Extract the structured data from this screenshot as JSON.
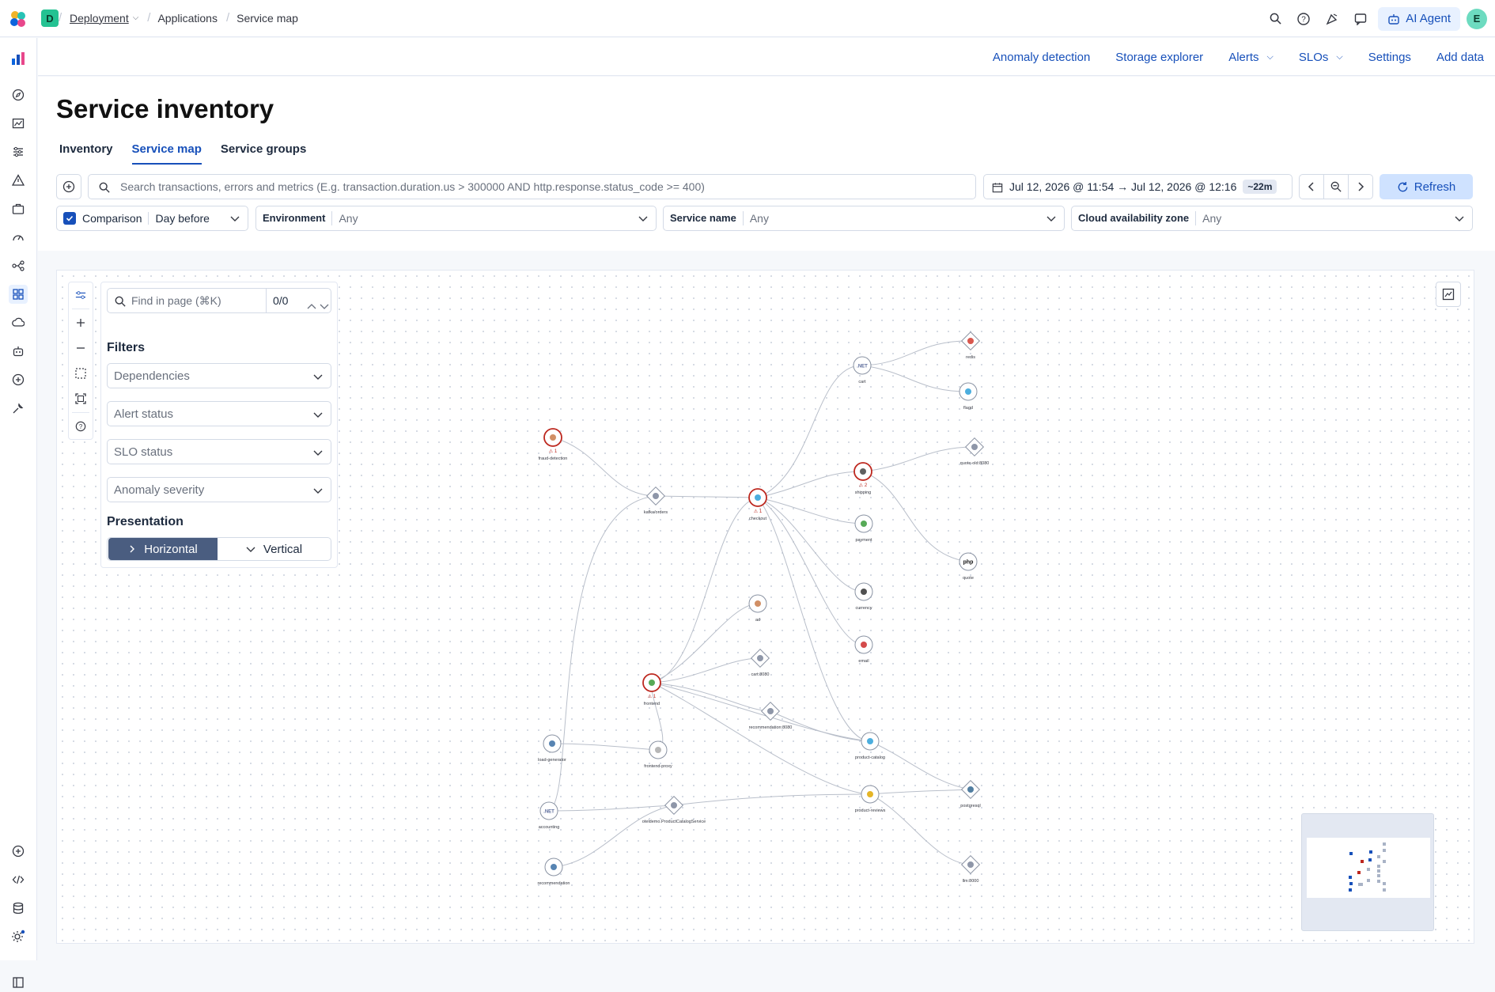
{
  "breadcrumbs": {
    "space_initial": "D",
    "items": [
      "Deployment",
      "Applications",
      "Service map"
    ]
  },
  "topbar": {
    "ai_agent_label": "AI Agent",
    "user_initial": "E"
  },
  "subnav": {
    "items": [
      "Anomaly detection",
      "Storage explorer",
      "Alerts",
      "SLOs",
      "Settings",
      "Add data"
    ]
  },
  "page": {
    "title": "Service inventory",
    "tabs": [
      "Inventory",
      "Service map",
      "Service groups"
    ],
    "selected_tab": "Service map"
  },
  "query": {
    "placeholder": "Search transactions, errors and metrics (E.g. transaction.duration.us > 300000 AND http.response.status_code >= 400)"
  },
  "date": {
    "range": "Jul 12, 2026 @ 11:54 → Jul 12, 2026 @ 12:16",
    "duration": "~22m",
    "refresh_label": "Refresh"
  },
  "filters": {
    "comparison_label": "Comparison",
    "comparison_checked": true,
    "comparison_value": "Day before",
    "environment_label": "Environment",
    "environment_value": "Any",
    "service_name_label": "Service name",
    "service_name_value": "Any",
    "cloud_zone_label": "Cloud availability zone",
    "cloud_zone_value": "Any"
  },
  "map_panel": {
    "find_placeholder": "Find in page (⌘K)",
    "find_count": "0/0",
    "filters_heading": "Filters",
    "dropdowns": [
      "Dependencies",
      "Alert status",
      "SLO status",
      "Anomaly severity"
    ],
    "presentation_heading": "Presentation",
    "presentation_options": [
      "Horizontal",
      "Vertical"
    ],
    "presentation_selected": "Horizontal"
  },
  "nodes": [
    {
      "id": "fraud-detection",
      "label": "fraud-detection",
      "kind": "service",
      "alerts": "1"
    },
    {
      "id": "kafka",
      "label": "kafka/orders",
      "kind": "dependency"
    },
    {
      "id": "checkout",
      "label": "checkout",
      "kind": "service",
      "alerts": "1"
    },
    {
      "id": "cart",
      "label": "cart",
      "kind": "service",
      "icon": ".NET"
    },
    {
      "id": "redis",
      "label": "redis",
      "kind": "dependency"
    },
    {
      "id": "flagd",
      "label": "flagd",
      "kind": "service"
    },
    {
      "id": "shipping",
      "label": "shipping",
      "kind": "service",
      "alerts": "2"
    },
    {
      "id": "quote-old",
      "label": "quote-old:8080",
      "kind": "dependency"
    },
    {
      "id": "payment",
      "label": "payment",
      "kind": "service"
    },
    {
      "id": "quote",
      "label": "quote",
      "kind": "service",
      "icon": "php"
    },
    {
      "id": "currency",
      "label": "currency",
      "kind": "service"
    },
    {
      "id": "ad",
      "label": "ad",
      "kind": "service"
    },
    {
      "id": "email",
      "label": "email",
      "kind": "service"
    },
    {
      "id": "cart8080",
      "label": "cart:8080",
      "kind": "dependency"
    },
    {
      "id": "frontend",
      "label": "frontend",
      "kind": "service",
      "alerts": "1"
    },
    {
      "id": "recommendation8080",
      "label": "recommendation:8080",
      "kind": "dependency"
    },
    {
      "id": "product-catalog",
      "label": "product-catalog",
      "kind": "service"
    },
    {
      "id": "load-generator",
      "label": "load-generator",
      "kind": "service"
    },
    {
      "id": "frontend-proxy",
      "label": "frontend-proxy",
      "kind": "service"
    },
    {
      "id": "accounting",
      "label": "accounting",
      "kind": "service",
      "icon": ".NET"
    },
    {
      "id": "oteldemo",
      "label": "oteldemo.ProductCatalogService",
      "kind": "dependency"
    },
    {
      "id": "product-reviews",
      "label": "product-reviews",
      "kind": "service"
    },
    {
      "id": "postgresql",
      "label": "postgresql",
      "kind": "dependency"
    },
    {
      "id": "recommendation",
      "label": "recommendation",
      "kind": "service"
    },
    {
      "id": "llm",
      "label": "llm:8000",
      "kind": "dependency"
    }
  ],
  "colors": {
    "accent": "#1750ba",
    "alert": "#bd271e",
    "space_badge": "#24c292"
  }
}
